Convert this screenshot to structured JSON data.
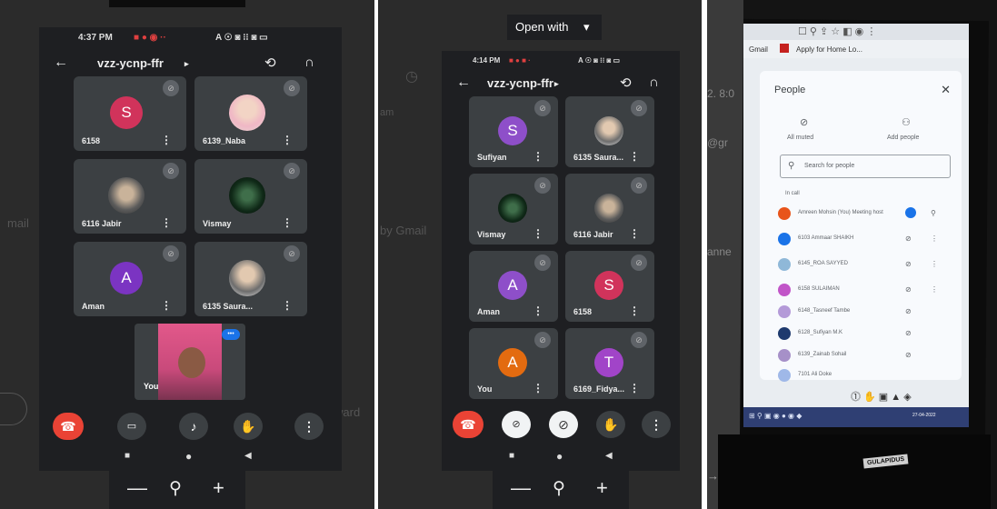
{
  "left": {
    "status_time": "4:37 PM",
    "status_icons": "A ☉ ◙ ⁝⁝ ◙ ▭",
    "meeting_code": "vzz-ycnp-ffr",
    "participants": [
      {
        "name": "6158",
        "initial": "S",
        "color": "#d1335b"
      },
      {
        "name": "6139_Naba",
        "initial": "",
        "color": "#f0b7c5"
      },
      {
        "name": "6116 Jabir",
        "initial": "",
        "color": "#5b5b5b"
      },
      {
        "name": "Vismay",
        "initial": "",
        "color": "#102a18"
      },
      {
        "name": "Aman",
        "initial": "A",
        "color": "#7b34c2"
      },
      {
        "name": "6135 Saura...",
        "initial": "",
        "color": "#6d6d6d"
      }
    ],
    "self_label": "You",
    "bg_left_text": "mail",
    "bg_right_text": "ward"
  },
  "middle": {
    "open_with_label": "Open with",
    "status_time": "4:14 PM",
    "meeting_code": "vzz-ycnp-ffr",
    "participants": [
      {
        "name": "Sufiyan",
        "initial": "S",
        "color": "#8e4fc9"
      },
      {
        "name": "6135 Saura...",
        "initial": "",
        "color": "#6d6d6d"
      },
      {
        "name": "Vismay",
        "initial": "",
        "color": "#102a18"
      },
      {
        "name": "6116 Jabir",
        "initial": "",
        "color": "#5b5b5b"
      },
      {
        "name": "Aman",
        "initial": "A",
        "color": "#8e4fc9"
      },
      {
        "name": "6158",
        "initial": "S",
        "color": "#d1335b"
      },
      {
        "name": "You",
        "initial": "A",
        "color": "#e36b10"
      },
      {
        "name": "6169_Fidya...",
        "initial": "T",
        "color": "#a144c8"
      }
    ],
    "bg_left_text": "by Gmail",
    "bg_right_text": "am"
  },
  "right": {
    "gmail_tab": "Gmail",
    "gmail_subject": "Apply for Home Lo...",
    "people_title": "People",
    "all_muted": "All muted",
    "add_people": "Add people",
    "search_placeholder": "Search for people",
    "in_call": "In call",
    "rows": [
      {
        "label": "Amreen Mohsin (You) Meeting host",
        "color": "#e8541a"
      },
      {
        "label": "6103 Ammaar SHAIKH",
        "color": "#1a73e8"
      },
      {
        "label": "6145_ROA SAYYED",
        "color": "#8fb8d8"
      },
      {
        "label": "6158 SULAIMAN",
        "color": "#c155c8"
      },
      {
        "label": "6148_Tasneef Tambe",
        "color": "#b49ad8"
      },
      {
        "label": "6128_Sufiyan M.K",
        "color": "#1e3a6e"
      },
      {
        "label": "6139_Zainab Sohail",
        "color": "#a690c8"
      },
      {
        "label": "7101 Ali Doke",
        "color": "#9fb8e8"
      }
    ],
    "taskbar_date": "27-04-2022",
    "laptop_brand": "GULAPIDUS"
  }
}
